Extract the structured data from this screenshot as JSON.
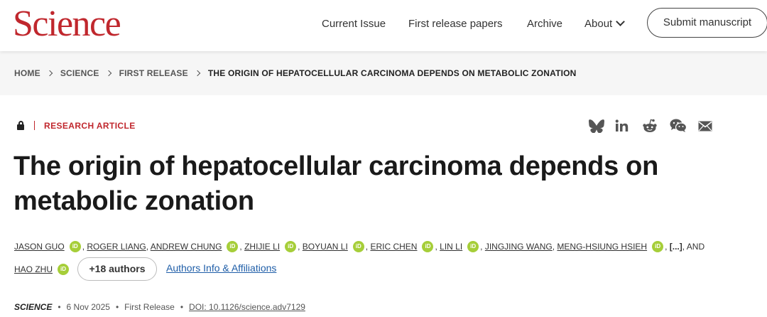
{
  "header": {
    "logo": "Science",
    "nav": {
      "current_issue": "Current Issue",
      "first_release": "First release papers",
      "archive": "Archive",
      "about": "About"
    },
    "submit_label": "Submit manuscript"
  },
  "breadcrumb": [
    "HOME",
    "SCIENCE",
    "FIRST RELEASE",
    "THE ORIGIN OF HEPATOCELLULAR CARCINOMA DEPENDS ON METABOLIC ZONATION"
  ],
  "article": {
    "type": "RESEARCH ARTICLE",
    "title_line1": "The origin of hepatocellular carcinoma depends on",
    "title_line2": "metabolic zonation",
    "share_icons": [
      "bluesky-icon",
      "linkedin-icon",
      "reddit-icon",
      "wechat-icon",
      "email-icon"
    ],
    "authors": [
      {
        "name": "JASON GUO",
        "orcid": true
      },
      {
        "name": "ROGER LIANG",
        "orcid": false
      },
      {
        "name": "ANDREW CHUNG",
        "orcid": true
      },
      {
        "name": "ZHIJIE LI",
        "orcid": true
      },
      {
        "name": "BOYUAN LI",
        "orcid": true
      },
      {
        "name": "ERIC CHEN",
        "orcid": true
      },
      {
        "name": "LIN LI",
        "orcid": true
      },
      {
        "name": "JINGJING WANG",
        "orcid": false
      },
      {
        "name": "MENG-HSIUNG HSIEH",
        "orcid": true
      },
      {
        "name": "HAO ZHU",
        "orcid": true
      }
    ],
    "ellipsis": "[...]",
    "and_text": ", AND",
    "orcid_label": "iD",
    "more_authors_label": "+18 authors",
    "affiliations_link": "Authors Info & Affiliations",
    "citation": {
      "journal": "SCIENCE",
      "date": "6 Nov 2025",
      "section": "First Release",
      "doi": "DOI: 10.1126/science.adv7129"
    }
  },
  "colors": {
    "brand_red": "#c0272d",
    "orcid_green": "#a6ce39",
    "link_blue": "#1f5ea8"
  }
}
